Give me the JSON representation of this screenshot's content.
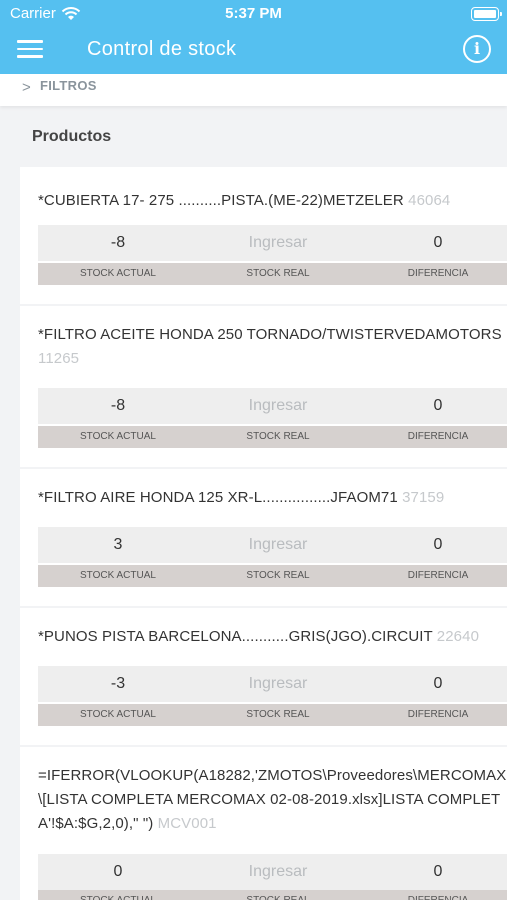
{
  "status_bar": {
    "carrier": "Carrier",
    "time": "5:37 PM"
  },
  "app_bar": {
    "title": "Control de stock",
    "menu_icon": "hamburger-menu-icon",
    "info_icon": "info-icon",
    "info_glyph": "i"
  },
  "filters": {
    "label": "FILTROS",
    "chevron": ">"
  },
  "section_title": "Productos",
  "column_labels": {
    "actual": "STOCK ACTUAL",
    "real": "STOCK REAL",
    "diff": "DIFERENCIA"
  },
  "colors": {
    "primary": "#55c0f0",
    "header_row": "#d6d1cf",
    "value_row": "#eeeeee"
  },
  "products": [
    {
      "name": "*CUBIERTA 17- 275 ..........PISTA.(ME-22)METZELER",
      "code": "46064",
      "stock_actual": "-8",
      "stock_real_placeholder": "Ingresar",
      "diferencia": "0"
    },
    {
      "name": "*FILTRO ACEITE HONDA 250 TORNADO/TWISTERVEDAMOTORS",
      "code": "11265",
      "stock_actual": "-8",
      "stock_real_placeholder": "Ingresar",
      "diferencia": "0"
    },
    {
      "name": "*FILTRO AIRE HONDA 125 XR-L................JFAOM71",
      "code": "37159",
      "stock_actual": "3",
      "stock_real_placeholder": "Ingresar",
      "diferencia": "0"
    },
    {
      "name": "*PUNOS PISTA BARCELONA...........GRIS(JGO).CIRCUIT",
      "code": "22640",
      "stock_actual": "-3",
      "stock_real_placeholder": "Ingresar",
      "diferencia": "0"
    },
    {
      "name": "=IFERROR(VLOOKUP(A18282,'ZMOTOS\\Proveedores\\MERCOMAX\\[LISTA COMPLETA MERCOMAX 02-08-2019.xlsx]LISTA COMPLETA'!$A:$G,2,0),\" \")",
      "code": "MCV001",
      "stock_actual": "0",
      "stock_real_placeholder": "Ingresar",
      "diferencia": "0"
    }
  ]
}
